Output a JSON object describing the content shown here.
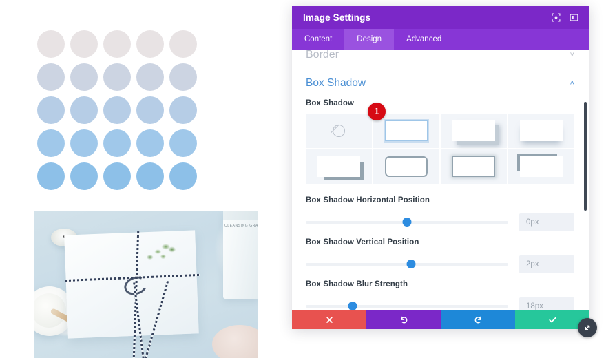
{
  "panel": {
    "title": "Image Settings",
    "header_icons": [
      {
        "name": "fullscreen-icon",
        "label": "Fullscreen"
      },
      {
        "name": "panel-layout-icon",
        "label": "Change Layout"
      }
    ],
    "tabs": [
      {
        "label": "Content",
        "active": false
      },
      {
        "label": "Design",
        "active": true
      },
      {
        "label": "Advanced",
        "active": false
      }
    ],
    "sections": [
      {
        "name": "Border",
        "state": "collapsed",
        "chevron": "˅"
      },
      {
        "name": "Box Shadow",
        "state": "open",
        "chevron": "˄"
      }
    ],
    "box_shadow": {
      "field_label": "Box Shadow",
      "presets": [
        {
          "name": "none",
          "selected": false
        },
        {
          "name": "selected-flat",
          "selected": true
        },
        {
          "name": "bottom-right-hard",
          "selected": false
        },
        {
          "name": "bottom-soft",
          "selected": false
        },
        {
          "name": "corner-bottom-right",
          "selected": false
        },
        {
          "name": "outline-rounded",
          "selected": false
        },
        {
          "name": "glow-ring",
          "selected": false
        },
        {
          "name": "corner-top-left",
          "selected": false
        }
      ]
    },
    "sliders": [
      {
        "label": "Box Shadow Horizontal Position",
        "value": "0px",
        "percent": 50
      },
      {
        "label": "Box Shadow Vertical Position",
        "value": "2px",
        "percent": 52
      },
      {
        "label": "Box Shadow Blur Strength",
        "value": "18px",
        "percent": 23
      }
    ],
    "actions": [
      {
        "name": "cancel",
        "icon": "x-icon",
        "color": "#e8524f"
      },
      {
        "name": "undo",
        "icon": "undo-icon",
        "color": "#7b28c8"
      },
      {
        "name": "redo",
        "icon": "redo-icon",
        "color": "#1e88d8"
      },
      {
        "name": "save",
        "icon": "check-icon",
        "color": "#26c79b"
      }
    ],
    "colors": {
      "header": "#7b28c8",
      "tabbar": "#8736d6",
      "tab_active": "#9a52e0",
      "section_open": "#4a8fd4",
      "slider_knob": "#2d8ce0",
      "scrollbar": "#3f4854"
    }
  },
  "annotation": {
    "badge_number": "1"
  },
  "preview": {
    "dots": {
      "rows": 5,
      "columns": 5,
      "row_colors": [
        "#e8e3e4",
        "#ccd4e2",
        "#b6cde6",
        "#a0c8ea",
        "#8dc0e8"
      ]
    },
    "photo": {
      "alt": "Flat lay of white wrapped gift package tied with striped twine",
      "bottle_label": "CLEANSING GRAINS"
    }
  },
  "resize_handle": {
    "name": "resize-handle",
    "icon": "diagonal-arrow-icon"
  }
}
